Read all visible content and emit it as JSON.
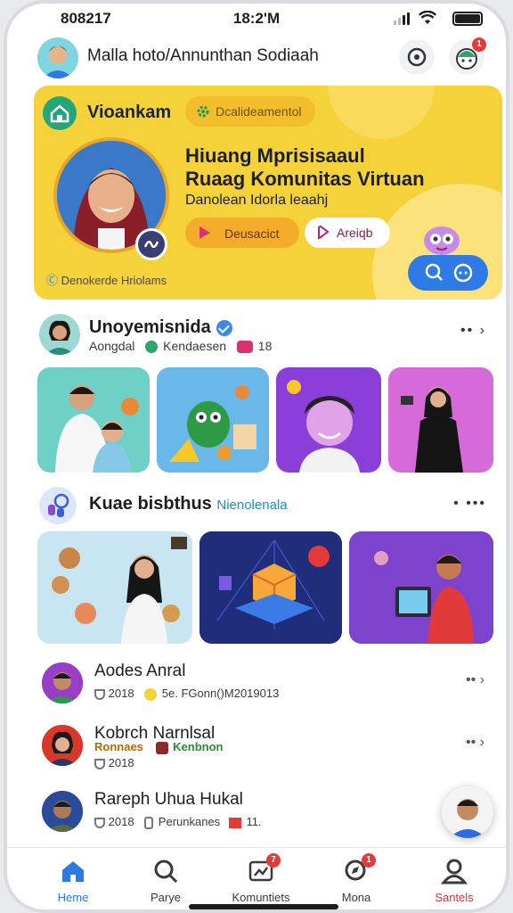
{
  "status_bar": {
    "left_time": "808217",
    "center_time": "18:2'M"
  },
  "header": {
    "user_name": "Malla hoto/Annunthan Sodiaah",
    "notification_count": "1"
  },
  "hero": {
    "brand": "Vioankam",
    "badge_label": "Dcalideamentol",
    "title_line1": "Hiuang Mprisisaaul",
    "title_line2": "Ruaag Komunitas Virtuan",
    "subtitle": "Danolean Idorla leaahj",
    "primary_button": "Deusacict",
    "secondary_button": "Areiqb",
    "footer_text": "Denokerde Hriolams"
  },
  "section1": {
    "title": "Unoyemisnida",
    "meta_text": "Aongdal",
    "meta_tag": "Kendaesen",
    "meta_count": "18"
  },
  "section2": {
    "title": "Kuae bisbthus",
    "link": "Nienolenala"
  },
  "list": [
    {
      "name": "Aodes Anral",
      "meta": "2018",
      "meta2": "5e. FGonn()M2019013"
    },
    {
      "name": "Kobrch Narnlsal",
      "tag1": "Ronnaes",
      "tag2": "Kenbnon",
      "meta": "2018"
    },
    {
      "name": "Rareph Uhua Hukal",
      "meta": "2018",
      "meta2": "Perunkanes",
      "count": "11."
    }
  ],
  "nav": [
    {
      "label": "Heme",
      "icon": "home-icon"
    },
    {
      "label": "Parye",
      "icon": "search-icon"
    },
    {
      "label": "Komuntiets",
      "icon": "community-icon",
      "badge": "7"
    },
    {
      "label": "Mona",
      "icon": "explore-icon",
      "badge": "1"
    },
    {
      "label": "Santels",
      "icon": "profile-icon"
    }
  ],
  "colors": {
    "accent": "#2c7be0",
    "hero_bg": "#f6d23a",
    "badge_red": "#e43a3a"
  }
}
